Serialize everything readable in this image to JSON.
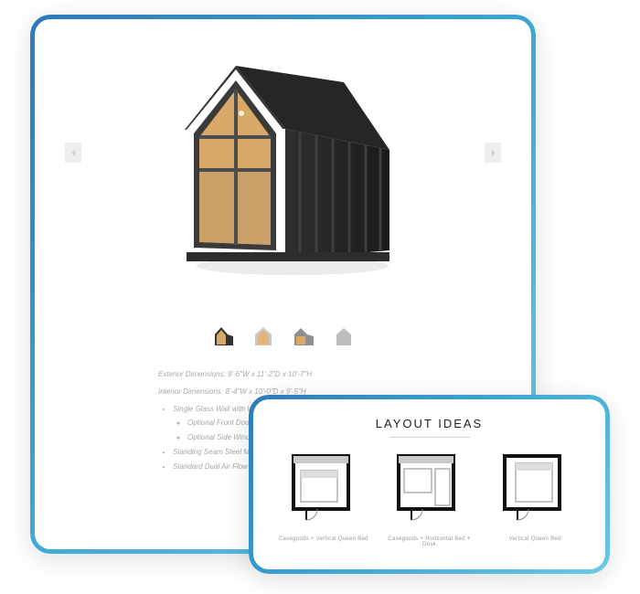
{
  "specs": {
    "exterior": "Exterior Dimensions: 9'-6\"W x 11'-2\"D x 10'-7\"H",
    "interior": "Interior Dimensions: 8'-4\"W x 10'-0\"D x 9'-5\"H",
    "features": [
      "Single Glass Wall with Wood Framed Glass Door (with bug screen)",
      "Standing Seam Steel Metal Roof / Roofing Membranes",
      "Standard Dual Air Flow Skylight (installed by contractor)"
    ],
    "sub_options": [
      "Optional Front Door Screen",
      "Optional Side Window Screen"
    ]
  },
  "layout": {
    "title": "LAYOUT IDEAS",
    "plans": [
      "Casegoods + Vertical Queen Bed",
      "Casegoods + Horizontal Bed + Desk",
      "Vertical Queen Bed"
    ]
  }
}
